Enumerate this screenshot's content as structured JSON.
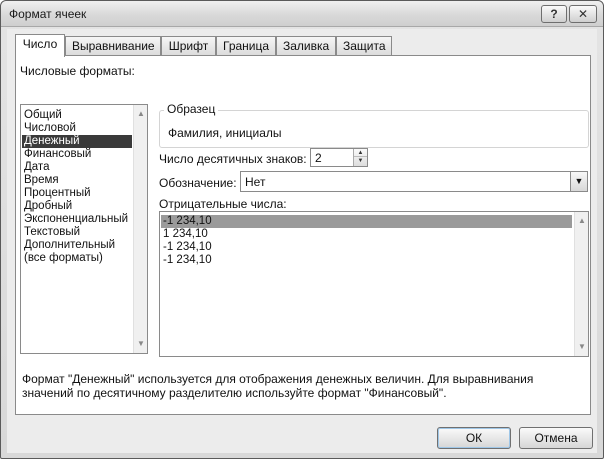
{
  "window": {
    "title": "Формат ячеек"
  },
  "titlebar_buttons": {
    "help": "?",
    "close": "✕"
  },
  "tabs": [
    {
      "label": "Число",
      "active": true
    },
    {
      "label": "Выравнивание",
      "active": false
    },
    {
      "label": "Шрифт",
      "active": false
    },
    {
      "label": "Граница",
      "active": false
    },
    {
      "label": "Заливка",
      "active": false
    },
    {
      "label": "Защита",
      "active": false
    }
  ],
  "number_formats": {
    "label": "Числовые форматы:",
    "items": [
      "Общий",
      "Числовой",
      "Денежный",
      "Финансовый",
      "Дата",
      "Время",
      "Процентный",
      "Дробный",
      "Экспоненциальный",
      "Текстовый",
      "Дополнительный",
      "(все форматы)"
    ],
    "selected_index": 2
  },
  "sample": {
    "legend": "Образец",
    "value": "Фамилия, инициалы"
  },
  "decimal_places": {
    "label": "Число десятичных знаков:",
    "value": "2"
  },
  "symbol": {
    "label": "Обозначение:",
    "value": "Нет"
  },
  "negative_numbers": {
    "label": "Отрицательные числа:",
    "items": [
      "-1 234,10",
      "1 234,10",
      "-1 234,10",
      "-1 234,10"
    ],
    "selected_index": 0
  },
  "description": "Формат \"Денежный\" используется для отображения денежных величин. Для выравнивания значений по десятичному разделителю используйте формат \"Финансовый\".",
  "buttons": {
    "ok": "ОК",
    "cancel": "Отмена"
  },
  "colors": {
    "selection": "#3a3a3a",
    "negative_selection": "#9a9a9a"
  }
}
